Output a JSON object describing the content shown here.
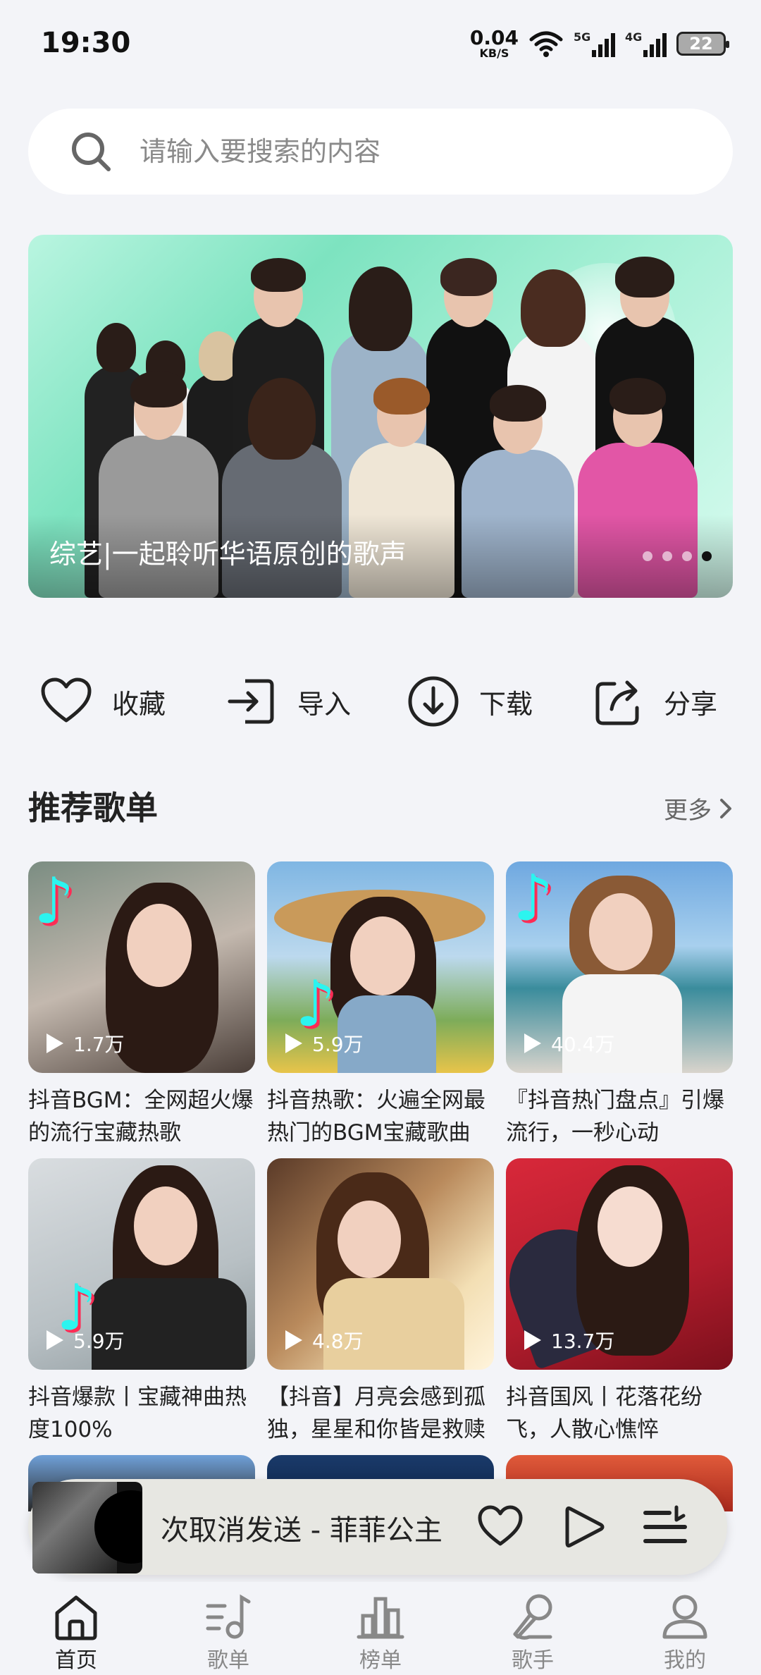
{
  "status_bar": {
    "time": "19:30",
    "net_speed_value": "0.04",
    "net_speed_unit": "KB/S",
    "signal_1_tag": "5G",
    "signal_2_tag": "4G",
    "battery": "22"
  },
  "search": {
    "placeholder": "请输入要搜索的内容"
  },
  "banner": {
    "caption": "综艺|一起聆听华语原创的歌声",
    "dot_count": 4,
    "active_dot": 4
  },
  "actions": [
    {
      "label": "收藏",
      "icon": "heart-icon"
    },
    {
      "label": "导入",
      "icon": "import-icon"
    },
    {
      "label": "下载",
      "icon": "download-icon"
    },
    {
      "label": "分享",
      "icon": "share-icon"
    }
  ],
  "recommend": {
    "title": "推荐歌单",
    "more": "更多",
    "playlists": [
      {
        "title": "抖音BGM：全网超火爆的流行宝藏热歌",
        "plays": "1.7万"
      },
      {
        "title": "抖音热歌：火遍全网最热门的BGM宝藏歌曲",
        "plays": "5.9万"
      },
      {
        "title": "『抖音热门盘点』引爆流行，一秒心动",
        "plays": "40.4万"
      },
      {
        "title": "抖音爆款丨宝藏神曲热度100%",
        "plays": "5.9万"
      },
      {
        "title": "【抖音】月亮会感到孤独，星星和你皆是救赎",
        "plays": "4.8万"
      },
      {
        "title": "抖音国风丨花落花纷飞，人散心憔悴",
        "plays": "13.7万"
      }
    ]
  },
  "player": {
    "now_playing": "次取消发送 - 菲菲公主（"
  },
  "bottom_nav": [
    {
      "label": "首页",
      "active": true
    },
    {
      "label": "歌单",
      "active": false
    },
    {
      "label": "榜单",
      "active": false
    },
    {
      "label": "歌手",
      "active": false
    },
    {
      "label": "我的",
      "active": false
    }
  ]
}
